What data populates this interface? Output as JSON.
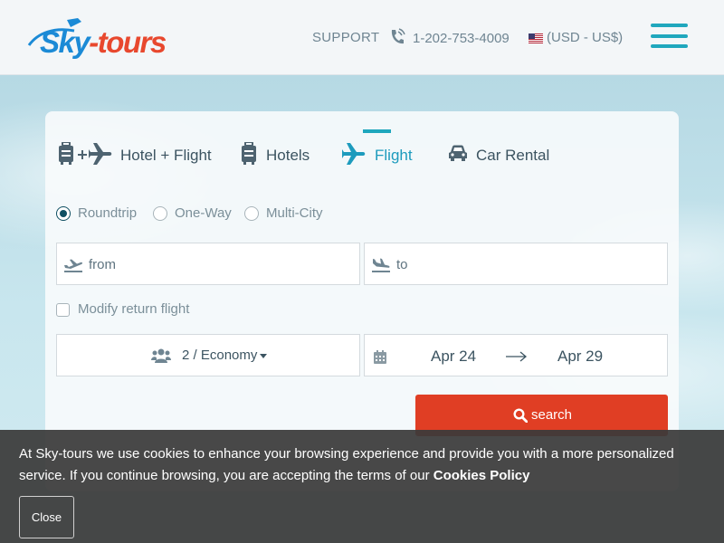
{
  "header": {
    "logo": {
      "part1": "Sky",
      "part2": "-tours"
    },
    "support_label": "SUPPORT",
    "phone_number": "1-202-753-4009",
    "currency_label": "(USD - US$)"
  },
  "tabs": [
    {
      "label": "Hotel + Flight",
      "icon": "luggage-plus-plane-icon",
      "active": false
    },
    {
      "label": "Hotels",
      "icon": "luggage-icon",
      "active": false
    },
    {
      "label": "Flight",
      "icon": "plane-icon",
      "active": true
    },
    {
      "label": "Car Rental",
      "icon": "car-icon",
      "active": false
    }
  ],
  "trip_types": [
    {
      "label": "Roundtrip",
      "checked": true
    },
    {
      "label": "One-Way",
      "checked": false
    },
    {
      "label": "Multi-City",
      "checked": false
    }
  ],
  "fields": {
    "from_placeholder": "from",
    "to_placeholder": "to"
  },
  "modify_return_label": "Modify return flight",
  "passengers_label": "2 / Economy",
  "dates": {
    "outbound": "Apr 24",
    "return": "Apr 29"
  },
  "search_label": "search",
  "cookie": {
    "text": "At Sky-tours we use cookies to enhance your browsing experience and provide you with a more personalized service. If you continue browsing, you are accepting the terms of our ",
    "link": "Cookies Policy",
    "close_label": "Close"
  },
  "colors": {
    "accent": "#1fa7bd",
    "search_button": "#e03e24",
    "logo_blue": "#1b8ad6",
    "logo_red": "#e8482e"
  }
}
